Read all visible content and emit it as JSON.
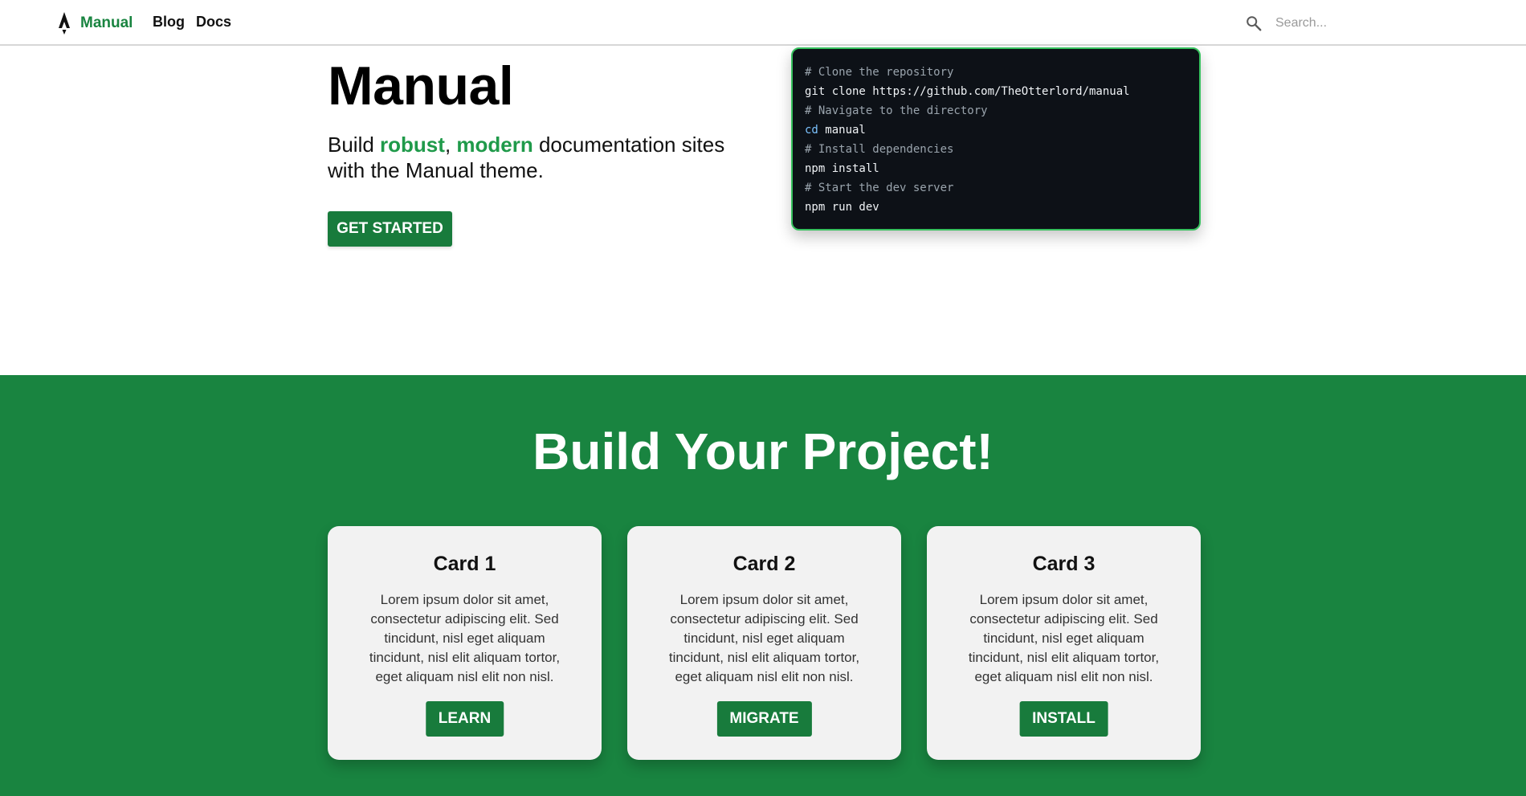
{
  "nav": {
    "brand": "Manual",
    "links": [
      "Blog",
      "Docs"
    ],
    "search_placeholder": "Search..."
  },
  "hero": {
    "title": "Manual",
    "tagline": {
      "part1": "Build ",
      "highlight1": "robust",
      "part2": ", ",
      "highlight2": "modern",
      "part3": " documentation sites with the Manual theme."
    },
    "cta_label": "GET STARTED"
  },
  "code": {
    "lines": [
      {
        "type": "comment",
        "text": "# Clone the repository"
      },
      {
        "type": "cmd",
        "text": "git clone https://github.com/TheOtterlord/manual"
      },
      {
        "type": "comment",
        "text": "# Navigate to the directory"
      },
      {
        "type": "cmd",
        "keyword": "cd",
        "text": " manual"
      },
      {
        "type": "comment",
        "text": "# Install dependencies"
      },
      {
        "type": "cmd",
        "text": "npm install"
      },
      {
        "type": "comment",
        "text": "# Start the dev server"
      },
      {
        "type": "cmd",
        "text": "npm run dev"
      }
    ]
  },
  "section": {
    "title": "Build Your Project!",
    "cards": [
      {
        "title": "Card 1",
        "text": "Lorem ipsum dolor sit amet, consectetur adipiscing elit. Sed tincidunt, nisl eget aliquam tincidunt, nisl elit aliquam tortor, eget aliquam nisl elit non nisl.",
        "button": "LEARN"
      },
      {
        "title": "Card 2",
        "text": "Lorem ipsum dolor sit amet, consectetur adipiscing elit. Sed tincidunt, nisl eget aliquam tincidunt, nisl elit aliquam tortor, eget aliquam nisl elit non nisl.",
        "button": "MIGRATE"
      },
      {
        "title": "Card 3",
        "text": "Lorem ipsum dolor sit amet, consectetur adipiscing elit. Sed tincidunt, nisl eget aliquam tincidunt, nisl elit aliquam tortor, eget aliquam nisl elit non nisl.",
        "button": "INSTALL"
      }
    ]
  },
  "colors": {
    "brand_green": "#198440",
    "highlight_green": "#1f9a4a",
    "button_green": "#187b3c",
    "code_bg": "#0d1117",
    "code_border": "#37c15e"
  }
}
